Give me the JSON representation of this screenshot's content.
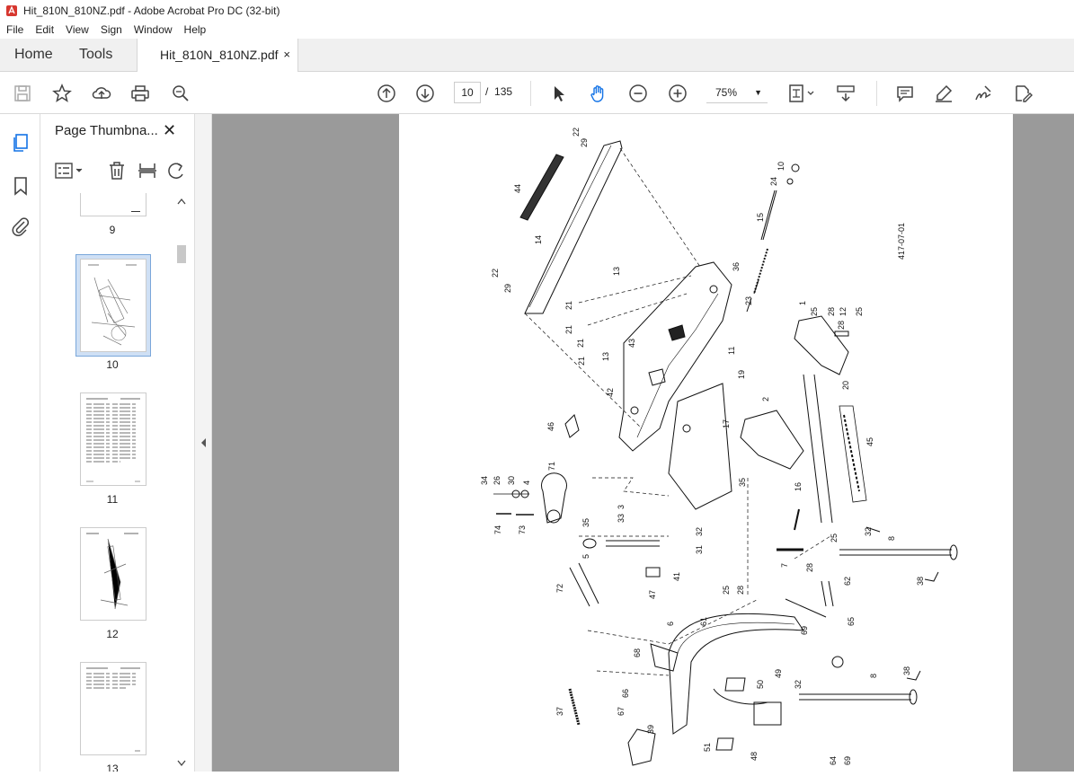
{
  "window": {
    "title": "Hit_810N_810NZ.pdf - Adobe Acrobat Pro DC (32-bit)"
  },
  "menu": [
    "File",
    "Edit",
    "View",
    "Sign",
    "Window",
    "Help"
  ],
  "tabs": {
    "home": "Home",
    "tools": "Tools",
    "document": "Hit_810N_810NZ.pdf",
    "close": "×"
  },
  "toolbar": {
    "page_current": "10",
    "page_sep": "/",
    "page_total": "135",
    "zoom": "75%"
  },
  "thumbnails": {
    "panel_title": "Page Thumbna...",
    "close": "✕",
    "pages": [
      "9",
      "10",
      "11",
      "12",
      "13"
    ],
    "selected_page": "10"
  },
  "drawing": {
    "ref_code": "417-07-01",
    "part_labels": [
      "22",
      "29",
      "44",
      "14",
      "10",
      "24",
      "15",
      "36",
      "23",
      "22",
      "29",
      "13",
      "21",
      "21",
      "21",
      "21",
      "13",
      "43",
      "11",
      "19",
      "42",
      "1",
      "12",
      "28",
      "25",
      "25",
      "28",
      "20",
      "2",
      "46",
      "17",
      "45",
      "34",
      "26",
      "30",
      "4",
      "71",
      "35",
      "3",
      "33",
      "32",
      "74",
      "73",
      "35",
      "5",
      "31",
      "16",
      "25",
      "8",
      "32",
      "7",
      "28",
      "62",
      "38",
      "72",
      "47",
      "41",
      "25",
      "28",
      "6",
      "61",
      "65",
      "68",
      "69",
      "49",
      "32",
      "37",
      "66",
      "67",
      "50",
      "39",
      "8",
      "38",
      "51",
      "48",
      "64",
      "69"
    ]
  },
  "icons": [
    "save-icon",
    "star-icon",
    "upload-icon",
    "print-icon",
    "zoom-search-icon",
    "page-up-icon",
    "page-down-icon",
    "select-arrow-icon",
    "hand-icon",
    "zoom-out-icon",
    "zoom-in-icon",
    "fit-page-icon",
    "scroll-mode-icon",
    "comment-icon",
    "highlight-icon",
    "sign-icon",
    "edit-icon"
  ]
}
